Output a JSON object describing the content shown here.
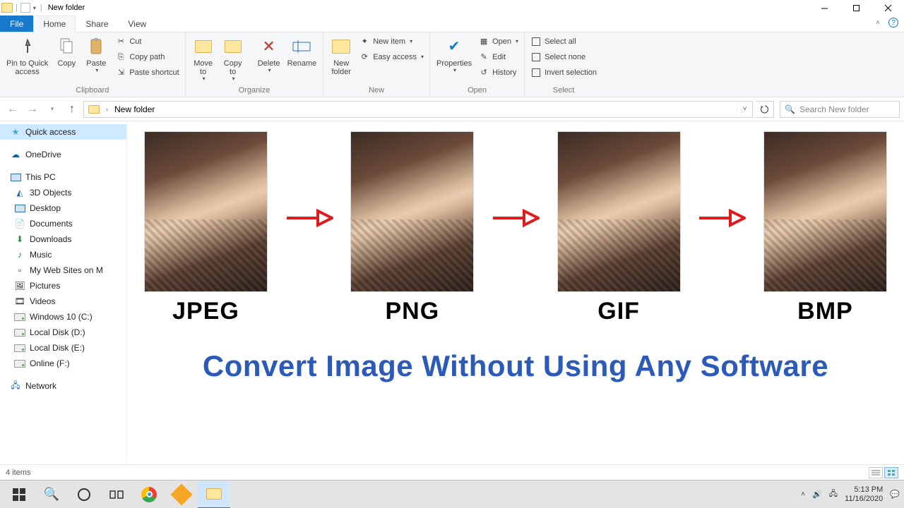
{
  "window": {
    "title": "New folder"
  },
  "tabs": {
    "file": "File",
    "home": "Home",
    "share": "Share",
    "view": "View"
  },
  "ribbon": {
    "clipboard": {
      "label": "Clipboard",
      "pin": "Pin to Quick\naccess",
      "copy": "Copy",
      "paste": "Paste",
      "cut": "Cut",
      "copypath": "Copy path",
      "pasteshortcut": "Paste shortcut"
    },
    "organize": {
      "label": "Organize",
      "moveto": "Move\nto",
      "copyto": "Copy\nto",
      "delete": "Delete",
      "rename": "Rename"
    },
    "new": {
      "label": "New",
      "newfolder": "New\nfolder",
      "newitem": "New item",
      "easyaccess": "Easy access"
    },
    "open": {
      "label": "Open",
      "properties": "Properties",
      "open": "Open",
      "edit": "Edit",
      "history": "History"
    },
    "select": {
      "label": "Select",
      "all": "Select all",
      "none": "Select none",
      "invert": "Invert selection"
    }
  },
  "breadcrumb": {
    "current": "New folder"
  },
  "search": {
    "placeholder": "Search New folder"
  },
  "sidebar": {
    "quickaccess": "Quick access",
    "onedrive": "OneDrive",
    "thispc": "This PC",
    "children": [
      "3D Objects",
      "Desktop",
      "Documents",
      "Downloads",
      "Music",
      "My Web Sites on M",
      "Pictures",
      "Videos",
      "Windows 10 (C:)",
      "Local Disk (D:)",
      "Local Disk (E:)",
      "Online (F:)"
    ],
    "network": "Network"
  },
  "content": {
    "formats": [
      "JPEG",
      "PNG",
      "GIF",
      "BMP"
    ],
    "banner": "Convert Image Without Using Any Software"
  },
  "status": {
    "count": "4 items"
  },
  "taskbar": {
    "time": "5:13 PM",
    "date": "11/16/2020"
  }
}
